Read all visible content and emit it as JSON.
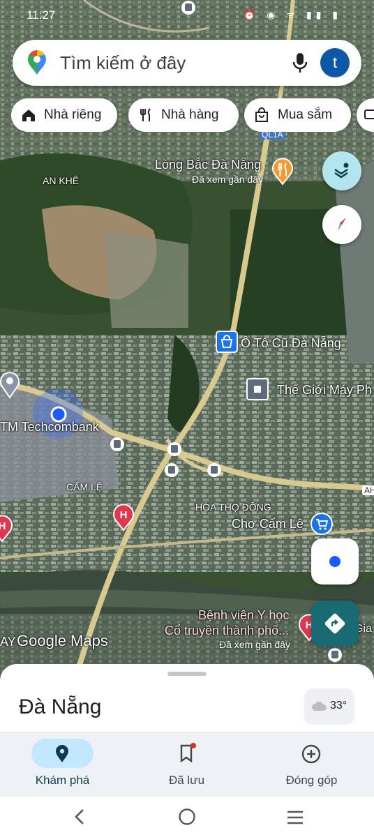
{
  "status_bar": {
    "time": "11:27",
    "icons": "⏰ ◉ ᯤ ▮▮ ▮"
  },
  "search": {
    "placeholder": "Tìm kiếm ở đây",
    "avatar_letter": "t"
  },
  "chips": [
    {
      "label": "Nhà riêng",
      "icon": "home-icon"
    },
    {
      "label": "Nhà hàng",
      "icon": "restaurant-icon"
    },
    {
      "label": "Mua sắm",
      "icon": "shopping-icon"
    }
  ],
  "map": {
    "labels": {
      "an_khe": "AN KHÊ",
      "long_bac": "Lòng Bắc Đà Nẵng",
      "long_bac_sub": "Đã xem gần đây",
      "oto": "Ô Tô Cũ Đà Nẵng",
      "the_gioi": "Thế Giới Máy Ph",
      "techcombank": "TM Techcombank",
      "cam_le": "CẨM LỆ",
      "hoa_tho": "HÒA THỌ ĐÔNG",
      "cho_cam_le": "Chợ Cẩm Lệ",
      "benh_vien_1": "Bệnh viện Y học",
      "benh_vien_2": "Cổ truyền thành phố...",
      "benh_vien_sub": "Đã xem gần đây",
      "road_qla": "QL1A",
      "road_ah": "AH",
      "gia": "Gia T",
      "ay": "AY",
      "google_maps": "Google Maps"
    }
  },
  "sheet": {
    "place_name": "Đà Nẵng",
    "temperature": "33°"
  },
  "bottom_nav": [
    {
      "label": "Khám phá",
      "icon": "explore-pin-icon",
      "active": true
    },
    {
      "label": "Đã lưu",
      "icon": "bookmark-icon",
      "active": false
    },
    {
      "label": "Đóng góp",
      "icon": "add-circle-icon",
      "active": false
    }
  ],
  "colors": {
    "accent": "#0b57a8",
    "nav_active_pill": "#c2e7ff",
    "directions_fab": "#1a6a73",
    "layers_fab": "#b3e5ee"
  }
}
